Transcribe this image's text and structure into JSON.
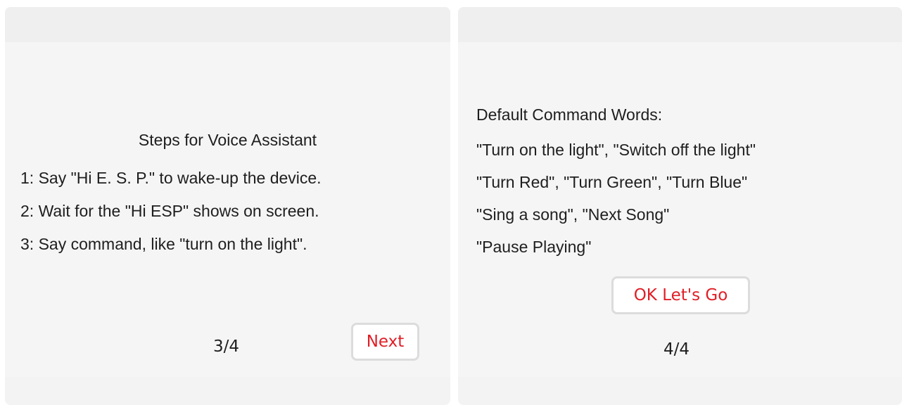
{
  "left_panel": {
    "title": "Steps for Voice Assistant",
    "steps": [
      "1: Say \"Hi E. S. P.\" to wake-up the device.",
      "2: Wait for the \"Hi ESP\" shows on screen.",
      "3: Say command, like \"turn on the light\"."
    ],
    "page_indicator": "3/4",
    "next_label": "Next"
  },
  "right_panel": {
    "title": "Default Command Words:",
    "commands": [
      "\"Turn on the light\", \"Switch off the light\"",
      "\"Turn Red\", \"Turn Green\", \"Turn Blue\"",
      "\"Sing a song\", \"Next Song\"",
      "\"Pause Playing\""
    ],
    "ok_label": "OK Let's Go",
    "page_indicator": "4/4"
  },
  "colors": {
    "accent": "#e01e26",
    "panel_background": "#f5f5f5",
    "text": "#1e1e1e"
  }
}
